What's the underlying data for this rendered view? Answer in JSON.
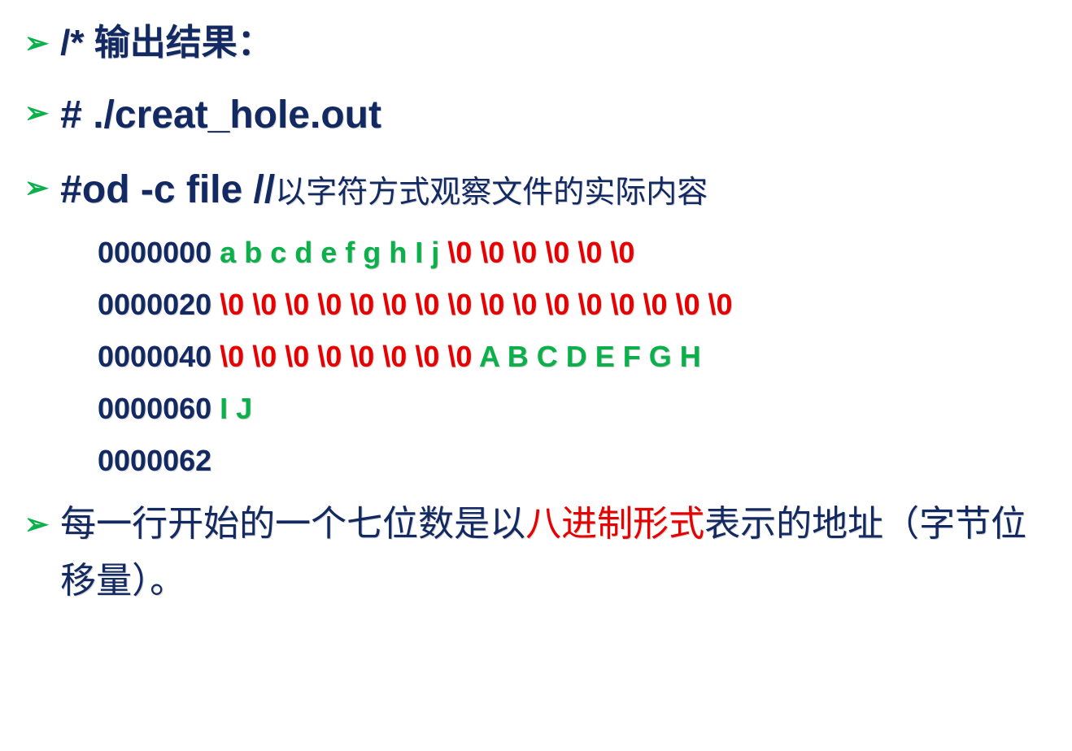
{
  "lines": {
    "l1": {
      "text": "/* 输出结果："
    },
    "l2": {
      "text": "# ./creat_hole.out"
    },
    "l3": {
      "cmd": "#od  -c  file     //",
      "comment": "以字符方式观察文件的实际内容"
    },
    "hex": {
      "r1": {
        "addr": "0000000",
        "green": "a   b   c   d   e   f   g   h   I   j",
        "red": "  \\0 \\0 \\0 \\0 \\0 \\0"
      },
      "r2": {
        "addr": "0000020",
        "red": "\\0 \\0 \\0 \\0 \\0 \\0 \\0 \\0 \\0 \\0 \\0 \\0 \\0 \\0 \\0 \\0"
      },
      "r3": {
        "addr": "0000040",
        "red": "\\0 \\0 \\0 \\0 \\0 \\0 \\0 \\0",
        "green": "  A B C D E  F  G H"
      },
      "r4": {
        "addr": "0000060",
        "green": "I J"
      },
      "r5": {
        "addr": "0000062"
      }
    },
    "final": {
      "part1": "每一行开始的一个七位数是以",
      "red": "八进制形式",
      "part2": "表示的地址（字节位移量）。"
    }
  },
  "bullet": "➢"
}
